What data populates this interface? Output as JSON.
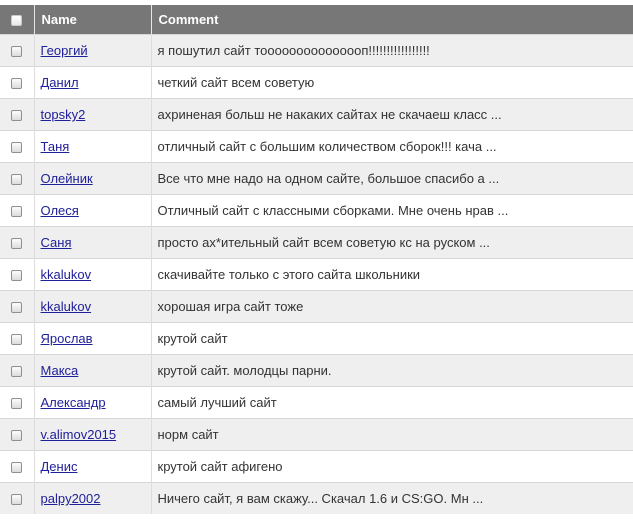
{
  "header": {
    "name_label": "Name",
    "comment_label": "Comment"
  },
  "colors": {
    "header_bg": "#777777",
    "row_odd_bg": "#efefef",
    "row_even_bg": "#ffffff",
    "link": "#20209a"
  },
  "rows": [
    {
      "name": "Георгий",
      "comment": "я пошутил сайт тооооооооооооооп!!!!!!!!!!!!!!!!!"
    },
    {
      "name": "Данил",
      "comment": "четкий сайт всем советую"
    },
    {
      "name": "topsky2",
      "comment": "ахриненая больш не накаких сайтах не скачаеш класс ..."
    },
    {
      "name": "Таня",
      "comment": "отличный сайт с большим количеством сборок!!! кача ..."
    },
    {
      "name": "Олейник",
      "comment": "Все что мне надо на одном сайте, большое спасибо а ..."
    },
    {
      "name": "Олеся",
      "comment": "Отличный сайт с классными сборками. Мне очень нрав ..."
    },
    {
      "name": "Саня",
      "comment": "просто ах*ительный сайт всем советую кс на руском ..."
    },
    {
      "name": "kkalukov",
      "comment": "скачивайте только с этого сайта школьники"
    },
    {
      "name": "kkalukov",
      "comment": "хорошая игра сайт тоже"
    },
    {
      "name": "Ярослав",
      "comment": "крутой сайт"
    },
    {
      "name": "Макса",
      "comment": "крутой сайт. молодцы парни."
    },
    {
      "name": "Александр",
      "comment": "самый лучший сайт"
    },
    {
      "name": "v.alimov2015",
      "comment": "норм сайт"
    },
    {
      "name": "Денис",
      "comment": "крутой сайт афигено"
    },
    {
      "name": "palpy2002",
      "comment": "Ничего сайт, я вам скажу... Скачал 1.6 и CS:GO. Мн ..."
    }
  ]
}
